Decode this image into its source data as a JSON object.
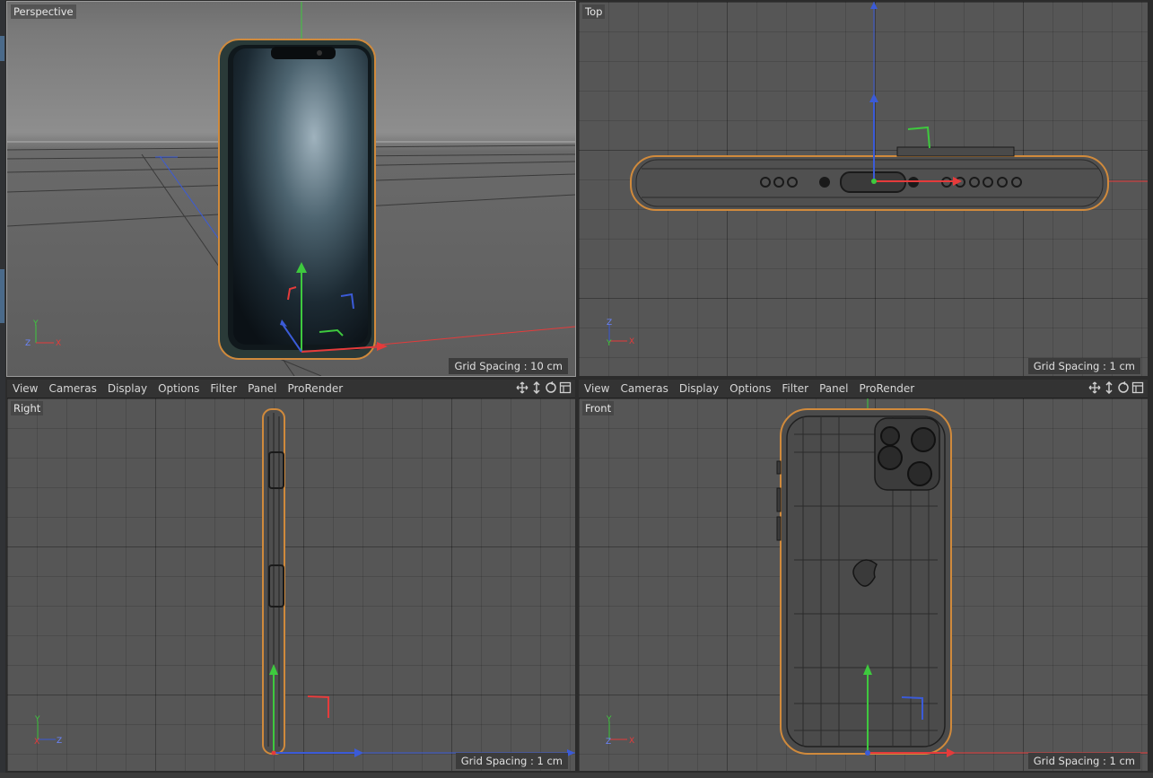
{
  "viewports": {
    "perspective": {
      "label": "Perspective",
      "grid_spacing": "Grid Spacing : 10 cm"
    },
    "top": {
      "label": "Top",
      "grid_spacing": "Grid Spacing : 1 cm"
    },
    "right": {
      "label": "Right",
      "grid_spacing": "Grid Spacing : 1 cm"
    },
    "front": {
      "label": "Front",
      "grid_spacing": "Grid Spacing : 1 cm"
    }
  },
  "menu": {
    "items": [
      "View",
      "Cameras",
      "Display",
      "Options",
      "Filter",
      "Panel",
      "ProRender"
    ]
  },
  "toolbar_icons": [
    "move-view-icon",
    "pan-view-icon",
    "rotate-view-icon",
    "maximize-view-icon"
  ],
  "axis_labels": {
    "x": "X",
    "y": "Y",
    "z": "Z"
  },
  "colors": {
    "x_axis": "#e53b3b",
    "y_axis": "#3ec93e",
    "z_axis": "#3b5bd8",
    "selection_outline": "#d08a3c",
    "viewport_bg": "#565656"
  }
}
